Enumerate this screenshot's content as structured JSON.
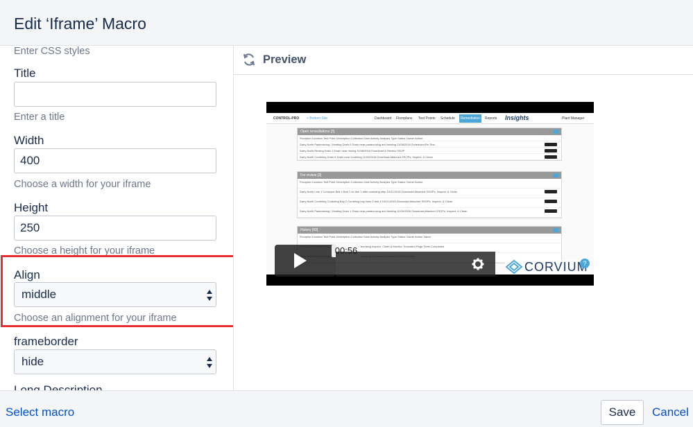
{
  "dialog": {
    "title": "Edit ‘Iframe’ Macro"
  },
  "form": {
    "css_help": "Enter CSS styles",
    "title_label": "Title",
    "title_value": "",
    "title_help": "Enter a title",
    "width_label": "Width",
    "width_value": "400",
    "width_help": "Choose a width for your iframe",
    "height_label": "Height",
    "height_value": "250",
    "height_help": "Choose a height for your iframe",
    "align_label": "Align",
    "align_value": "middle",
    "align_help": "Choose an alignment for your iframe",
    "frameborder_label": "frameborder",
    "frameborder_value": "hide",
    "long_description_label": "Long Description"
  },
  "preview": {
    "title": "Preview",
    "video": {
      "time": "00:56",
      "brand": "CORVIUM",
      "app_nav": [
        "CONTROL-PRO",
        "< Bottom Site",
        "Dashboard",
        "Floorplans",
        "Test Points",
        "Schedule",
        "Remediation",
        "Reports",
        "Insights",
        "Plant Manager"
      ],
      "panels": [
        {
          "heading": "Open remediations [3]",
          "rows": [
            "Floorplan   Location   Test Point   Description   Collection Date   Activity   Analysis Type   Status   Owner   Action",
            "Dairy North   Pasteurizing / Heating   Drain 6   Drain near pasteurizing and heating   11/08/2016   Scheduled Re-Test",
            "Dairy North   Rinsing   Drain 4   Drain near rinsing   11/08/2016   Download & Review SSOP",
            "Dairy North   Curdeling   Drain 6   Drain near curdeling   11/03/2016   Download Attached SSOPs, Inspect, & Clean"
          ]
        },
        {
          "heading": "For review [3]",
          "rows": [
            "Floorplan   Location   Test Point   Description   Collection Date   Activity   Analysis Type   Status   Owner   Action",
            "Dairy North   Line 1   Conveyor Belt 1   Belt 1 on line 1 after curdeling step   10/21/2016   Download Attached SSOPs, Inspect, & Clean",
            "Dairy North   Curdeling   Curdeling Bay 2   Curdeling bay lines 3 and 4   10/21/2016   Download Attached SSOPs, Inspect, & Clean",
            "Dairy North   Pasteurizing / Heating   Drain 1   Drain near pasteurizing and heating   10/20/2016   Download Attached SSOPs, Inspect, & Clean"
          ]
        },
        {
          "heading": "History [60]",
          "rows": [
            "Floorplan   Location   Test Point   Description   Collection Date   Activity   Analysis Type   Status   Owner   Action Taken",
            "Dairy North   Pasteurizing / Heating   Drain near pasteurizing   Inspect, Clean & Monitor   Truncated   Page Toms   Completed",
            "Dairy North   Pasteurizing / Heating   Drain near pasteurizing   Download Attached SSOPs   Closed"
          ]
        }
      ]
    }
  },
  "footer": {
    "select_macro": "Select macro",
    "save": "Save",
    "cancel": "Cancel"
  }
}
